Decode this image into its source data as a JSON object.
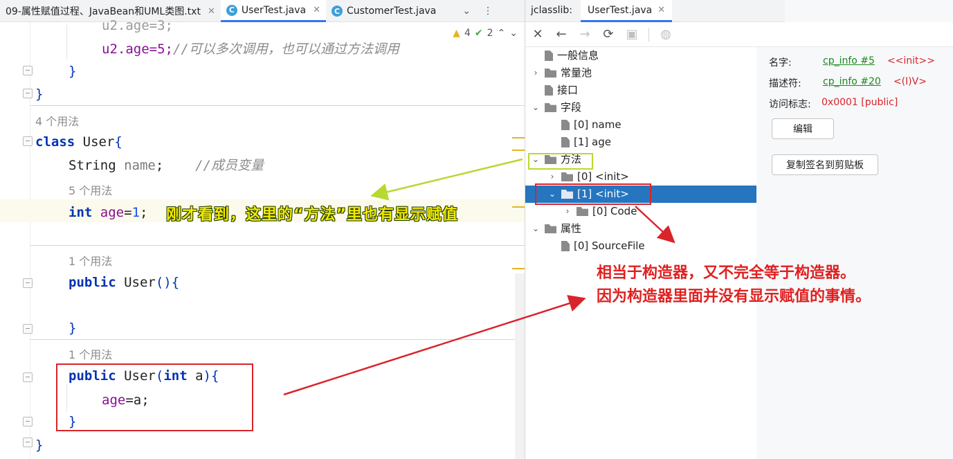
{
  "editor": {
    "tabs": [
      {
        "label": "09-属性赋值过程、JavaBean和UML类图.txt",
        "active": false,
        "has_icon": false
      },
      {
        "label": "UserTest.java",
        "active": true,
        "has_icon": true
      },
      {
        "label": "CustomerTest.java",
        "active": false,
        "has_icon": true
      }
    ],
    "tab_close": "✕",
    "tab_more_down": "⌄",
    "tab_more_menu": "⋮",
    "warnings_count": "4",
    "checks_count": "2",
    "code": {
      "line1": "u2.age=3;",
      "line2_code": "u2.age=5;",
      "line2_comment": "//可以多次调用，也可以通过方法调用",
      "usage4": "4 个用法",
      "class_kw": "class",
      "class_name": "User",
      "field1_type": "String",
      "field1_name": "name",
      "field1_comment": "//成员变量",
      "usage5": "5 个用法",
      "field2_type": "int",
      "field2_name": "age",
      "field2_value": "1",
      "usage1a": "1 个用法",
      "ctor_kw": "public",
      "ctor_name": "User",
      "usage1b": "1 个用法",
      "ctor2_param_type": "int",
      "ctor2_param": "a",
      "assign_field": "age",
      "assign_value": "a"
    },
    "callout": "刚才看到，这里的“方法”里也有显示赋值"
  },
  "panel": {
    "title": "jclasslib:",
    "tab_label": "UserTest.java",
    "tree": [
      {
        "label": "一般信息",
        "kind": "file"
      },
      {
        "label": "常量池",
        "kind": "folder",
        "chev": "›"
      },
      {
        "label": "接口",
        "kind": "file"
      },
      {
        "label": "字段",
        "kind": "folder",
        "chev": "⌄"
      },
      {
        "label": "[0] name",
        "kind": "file"
      },
      {
        "label": "[1] age",
        "kind": "file"
      },
      {
        "label": "方法",
        "kind": "folder",
        "chev": "⌄"
      },
      {
        "label": "[0] <init>",
        "kind": "folder",
        "chev": "›"
      },
      {
        "label": "[1] <init>",
        "kind": "folder",
        "chev": "⌄",
        "selected": true
      },
      {
        "label": "[0] Code",
        "kind": "folder",
        "chev": "›"
      },
      {
        "label": "属性",
        "kind": "folder",
        "chev": "⌄"
      },
      {
        "label": "[0] SourceFile",
        "kind": "file"
      }
    ],
    "details": {
      "name_label": "名字:",
      "name_link": "cp_info #5",
      "name_value": "<<init>>",
      "desc_label": "描述符:",
      "desc_link": "cp_info #20",
      "desc_value": "<(I)V>",
      "access_label": "访问标志:",
      "access_value": "0x0001 [public]",
      "edit_button": "编辑",
      "copy_button": "复制签名到剪贴板"
    }
  },
  "annotation": {
    "line1": "相当于构造器，又不完全等于构造器。",
    "line2": "因为构造器里面并没有显示赋值的事情。"
  },
  "colors": {
    "accent": "#3574f0",
    "selection": "#2675bf",
    "red": "#d9242b",
    "yellow_green": "#b7d930"
  }
}
